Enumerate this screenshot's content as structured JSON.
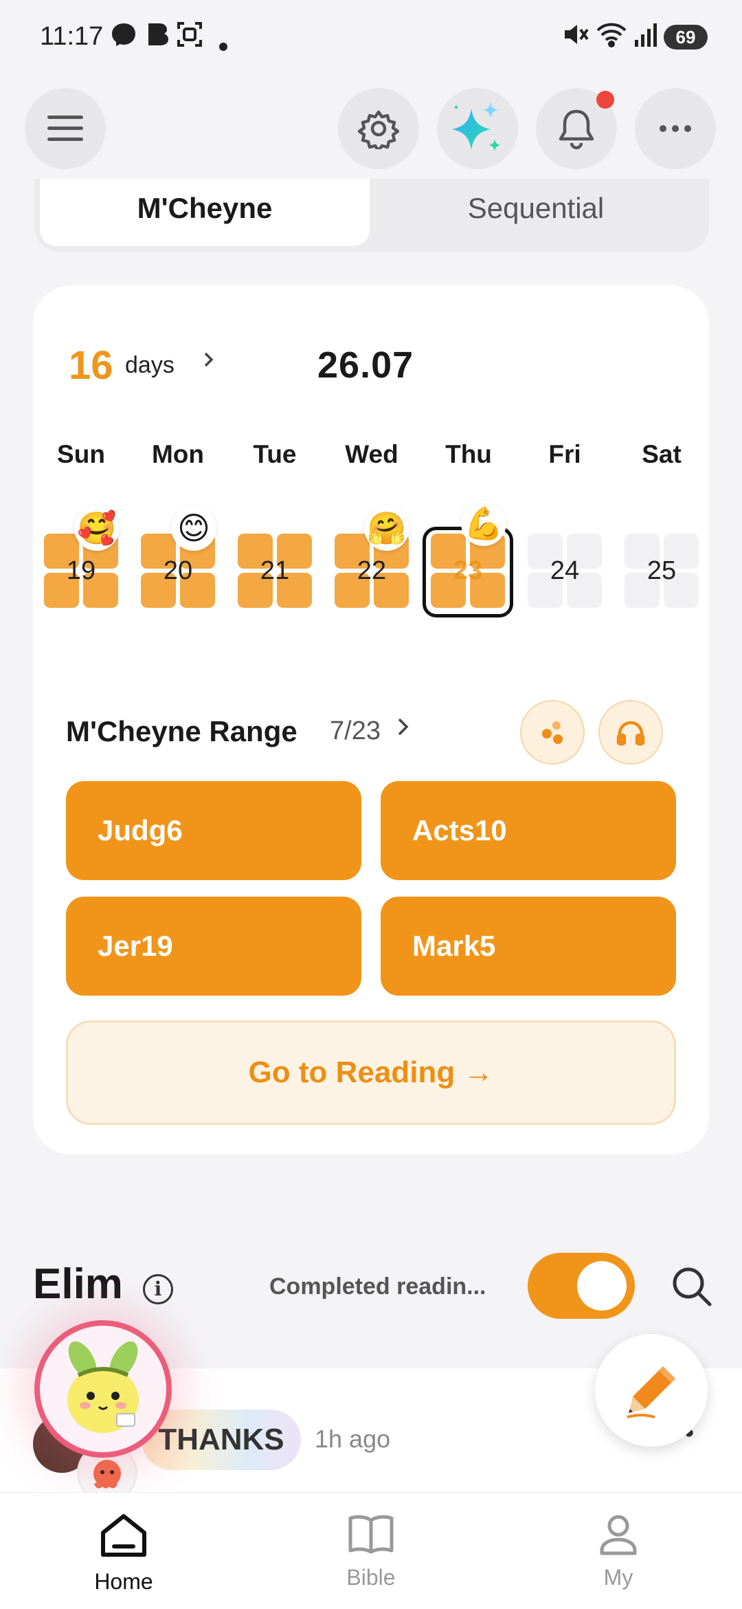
{
  "status_bar": {
    "time": "11:17",
    "battery": "69"
  },
  "tabs": [
    {
      "label": "M'Cheyne",
      "active": true
    },
    {
      "label": "Sequential",
      "active": false
    }
  ],
  "streak": {
    "count": "16",
    "unit": "days"
  },
  "current_date": "26.07",
  "weekdays": [
    "Sun",
    "Mon",
    "Tue",
    "Wed",
    "Thu",
    "Fri",
    "Sat"
  ],
  "days": [
    {
      "num": "19",
      "completed": true,
      "emoji": "🥰"
    },
    {
      "num": "20",
      "completed": true,
      "emoji": "😊"
    },
    {
      "num": "21",
      "completed": true,
      "emoji": ""
    },
    {
      "num": "22",
      "completed": true,
      "emoji": "🤗"
    },
    {
      "num": "23",
      "completed": true,
      "emoji": "💪",
      "today": true
    },
    {
      "num": "24",
      "completed": false,
      "emoji": ""
    },
    {
      "num": "25",
      "completed": false,
      "emoji": ""
    }
  ],
  "range": {
    "title": "M'Cheyne Range",
    "date": "7/23",
    "chapters": [
      "Judg6",
      "Acts10",
      "Jer19",
      "Mark5"
    ]
  },
  "go_button": "Go to Reading →",
  "group": {
    "name": "Elim",
    "filter_label": "Completed readin...",
    "filter_on": true
  },
  "feed": {
    "badge": "THANKS",
    "time_ago": "1h ago"
  },
  "nav": [
    {
      "label": "Home",
      "icon": "home-icon",
      "active": true
    },
    {
      "label": "Bible",
      "icon": "book-icon",
      "active": false
    },
    {
      "label": "My",
      "icon": "person-icon",
      "active": false
    }
  ],
  "colors": {
    "accent": "#f0951a",
    "accent_pale": "#fdf3e4",
    "inactive_cell": "#f1f1f3"
  }
}
